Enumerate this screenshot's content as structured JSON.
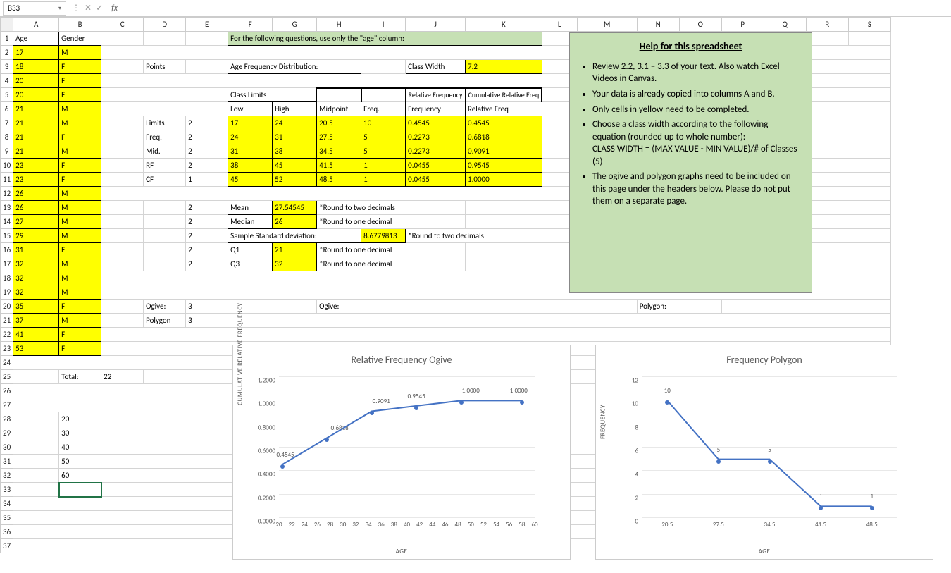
{
  "nameBox": "B33",
  "headers": {
    "A": "Age",
    "B": "Gender"
  },
  "banner": "For the following questions, use only the \"age\" column:",
  "pointsLabel": "Points",
  "ageFreqLabel": "Age Frequency Distribution:",
  "classWidthLabel": "Class Width",
  "classWidthVal": "7.2",
  "classLimitsLabel": "Class Limits",
  "fdHeaders": {
    "low": "Low",
    "high": "High",
    "mid": "Midpoint",
    "freq": "Freq.",
    "rel": "Relative Frequency",
    "cum": "Cumulative Relative Freq"
  },
  "labelsD": {
    "limits": "Limits",
    "freq": "Freq.",
    "mid": "Mid.",
    "rf": "RF",
    "cf": "CF"
  },
  "pointsVals": {
    "limits": "2",
    "freq": "2",
    "mid": "2",
    "rf": "2",
    "cf": "1"
  },
  "fdRows": [
    {
      "low": "17",
      "high": "24",
      "mid": "20.5",
      "freq": "10",
      "rel": "0.4545",
      "cum": "0.4545"
    },
    {
      "low": "24",
      "high": "31",
      "mid": "27.5",
      "freq": "5",
      "rel": "0.2273",
      "cum": "0.6818"
    },
    {
      "low": "31",
      "high": "38",
      "mid": "34.5",
      "freq": "5",
      "rel": "0.2273",
      "cum": "0.9091"
    },
    {
      "low": "38",
      "high": "45",
      "mid": "41.5",
      "freq": "1",
      "rel": "0.0455",
      "cum": "0.9545"
    },
    {
      "low": "45",
      "high": "52",
      "mid": "48.5",
      "freq": "1",
      "rel": "0.0455",
      "cum": "1.0000"
    }
  ],
  "stats": {
    "meanL": "Mean",
    "meanV": "27.54545",
    "meanN": "*Round to two decimals",
    "medianL": "Median",
    "medianV": "26",
    "medianN": "*Round to one decimal",
    "ssdL": "Sample Standard deviation:",
    "ssdV": "8.6779813",
    "ssdN": "*Round to two decimals",
    "q1L": "Q1",
    "q1V": "21",
    "q1N": "*Round to one decimal",
    "q3L": "Q3",
    "q3V": "32",
    "q3N": "*Round to one decimal"
  },
  "statPts": {
    "mean": "2",
    "median": "2",
    "ssd": "2",
    "q1": "2",
    "q3": "2"
  },
  "ogiveLabel": "Ogive:",
  "polygonLabel": "Polygon",
  "polygonHdr": "Polygon:",
  "ogivePts": "3",
  "polyPts": "3",
  "totalLabel": "Total:",
  "totalVal": "22",
  "extraB": {
    "r28": "20",
    "r29": "30",
    "r30": "40",
    "r31": "50",
    "r32": "60"
  },
  "ageData": [
    {
      "age": "17",
      "g": "M"
    },
    {
      "age": "18",
      "g": "F"
    },
    {
      "age": "20",
      "g": "F"
    },
    {
      "age": "20",
      "g": "F"
    },
    {
      "age": "21",
      "g": "M"
    },
    {
      "age": "21",
      "g": "M"
    },
    {
      "age": "21",
      "g": "F"
    },
    {
      "age": "21",
      "g": "M"
    },
    {
      "age": "23",
      "g": "F"
    },
    {
      "age": "23",
      "g": "F"
    },
    {
      "age": "26",
      "g": "M"
    },
    {
      "age": "26",
      "g": "M"
    },
    {
      "age": "27",
      "g": "M"
    },
    {
      "age": "29",
      "g": "M"
    },
    {
      "age": "31",
      "g": "F"
    },
    {
      "age": "32",
      "g": "M"
    },
    {
      "age": "32",
      "g": "M"
    },
    {
      "age": "32",
      "g": "M"
    },
    {
      "age": "35",
      "g": "F"
    },
    {
      "age": "37",
      "g": "M"
    },
    {
      "age": "41",
      "g": "F"
    },
    {
      "age": "53",
      "g": "F"
    }
  ],
  "help": {
    "title": "Help for this spreadsheet",
    "b1": "Review 2.2, 3.1 – 3.3 of your text. Also watch Excel Videos in Canvas.",
    "b2": "Your data is already copied into columns A and B.",
    "b3": "Only cells in yellow need to be completed.",
    "b4": "Choose a class width according to the following equation (rounded up to whole number):",
    "b4a": "CLASS WIDTH = (MAX VALUE - MIN VALUE)/# of Classes (5)",
    "b5": "The ogive and polygon graphs need to be included on this page under the headers below. Please do not put them on a separate page."
  },
  "chart_data": [
    {
      "type": "line",
      "title": "Relative Frequency Ogive",
      "xlabel": "AGE",
      "ylabel": "CUMULATIVE RELATIVE FREQUENCY",
      "x": [
        20.5,
        27.5,
        34.5,
        41.5,
        48.5,
        58
      ],
      "values": [
        0.4545,
        0.6818,
        0.9091,
        0.9545,
        1.0,
        1.0
      ],
      "data_labels": [
        "0.4545",
        "0.6818",
        "0.9091",
        "0.9545",
        "1.0000",
        "1.0000"
      ],
      "label_x": [
        21,
        29.5,
        36,
        41.5,
        50,
        57.5
      ],
      "xticks": [
        20,
        22,
        24,
        26,
        28,
        30,
        32,
        34,
        36,
        38,
        40,
        42,
        44,
        46,
        48,
        50,
        52,
        54,
        56,
        58,
        60
      ],
      "yticks": [
        0.0,
        0.2,
        0.4,
        0.6,
        0.8,
        1.0,
        1.2
      ],
      "ytick_labels": [
        "0.0000",
        "0.2000",
        "0.4000",
        "0.6000",
        "0.8000",
        "1.0000",
        "1.2000"
      ],
      "xlim": [
        20,
        60
      ],
      "ylim": [
        0,
        1.2
      ]
    },
    {
      "type": "line",
      "title": "Frequency Polygon",
      "xlabel": "AGE",
      "ylabel": "FREQUENCY",
      "categories": [
        "20.5",
        "27.5",
        "34.5",
        "41.5",
        "48.5"
      ],
      "values": [
        10,
        5,
        5,
        1,
        1
      ],
      "yticks": [
        0,
        2,
        4,
        6,
        8,
        10,
        12
      ],
      "ylim": [
        0,
        12
      ]
    }
  ]
}
